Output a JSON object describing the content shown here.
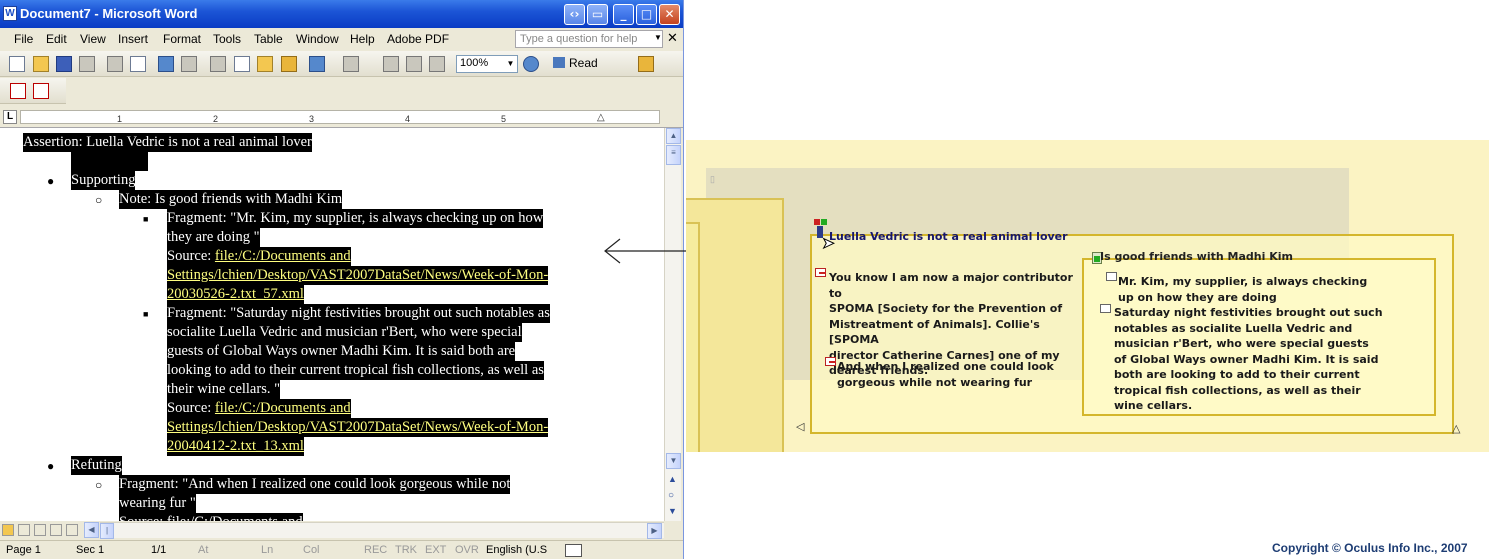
{
  "window": {
    "title": "Document7 - Microsoft Word",
    "app_icon": "W"
  },
  "menu": {
    "items": [
      "File",
      "Edit",
      "View",
      "Insert",
      "Format",
      "Tools",
      "Table",
      "Window",
      "Help",
      "Adobe PDF"
    ],
    "help_placeholder": "Type a question for help"
  },
  "toolbar": {
    "zoom": "100%",
    "read_label": "Read"
  },
  "ruler": {
    "ticks": [
      "1",
      "2",
      "3",
      "4",
      "5"
    ]
  },
  "document": {
    "assertion": "Assertion: Luella Vedric is not a real animal lover",
    "supporting": "Supporting",
    "note": "Note: Is good friends with Madhi Kim",
    "frag1_l1": "Fragment: \"Mr. Kim, my supplier, is always checking up on how",
    "frag1_l2": "they are doing \"",
    "src1_label": "Source: ",
    "src1_l1": "file:/C:/Documents and",
    "src1_l2": "Settings/lchien/Desktop/VAST2007DataSet/News/Week-of-Mon-",
    "src1_l3": "20030526-2.txt_57.xml",
    "frag2_l1": "Fragment: \"Saturday night festivities brought out such notables as",
    "frag2_l2": "socialite Luella Vedric and musician r'Bert, who were special",
    "frag2_l3": "guests of Global Ways owner Madhi Kim. It is said both are",
    "frag2_l4": "looking to add to their current tropical fish collections, as well as",
    "frag2_l5": "their wine cellars. \"",
    "src2_label": "Source: ",
    "src2_l1": "file:/C:/Documents and",
    "src2_l2": "Settings/lchien/Desktop/VAST2007DataSet/News/Week-of-Mon-",
    "src2_l3": "20040412-2.txt_13.xml",
    "refuting": "Refuting",
    "frag3_l1": "Fragment: \"And when I realized one could look gorgeous while not",
    "frag3_l2": "wearing fur \"",
    "src3_partial": "Source: file:/C:/Documents and"
  },
  "status": {
    "page": "Page  1",
    "sec": "Sec  1",
    "pages": "1/1",
    "at": "At",
    "ln": "Ln",
    "col": "Col",
    "rec": "REC",
    "trk": "TRK",
    "ext": "EXT",
    "ovr": "OVR",
    "lang": "English (U.S"
  },
  "visualization": {
    "assertion_title": "Luella Vedric is not a real animal lover",
    "frag_a": [
      "You know I am now a major contributor to",
      "SPOMA [Society for the Prevention of",
      "Mistreatment of Animals]. Collie's [SPOMA",
      "director Catherine Carnes] one of my",
      "dearest friends."
    ],
    "frag_b": [
      "And when I realized one could look",
      "gorgeous while not wearing fur"
    ],
    "note_title": "Is good friends with Madhi Kim",
    "note_frag1": [
      "Mr. Kim, my supplier, is always checking",
      "up on how they are doing"
    ],
    "note_frag2": [
      "Saturday night festivities brought out such",
      "notables as socialite Luella Vedric and",
      "musician r'Bert, who were special guests",
      "of Global Ways owner Madhi Kim. It is said",
      "both are looking to add to their current",
      "tropical fish collections, as well as their",
      "wine cellars."
    ]
  },
  "copyright": "Copyright © Oculus Info Inc., 2007",
  "colors": {
    "titlebar": "#1c55d6",
    "vis_background": "#fbf3c3",
    "vis_border": "#d4b62c",
    "highlight": "#000000"
  }
}
